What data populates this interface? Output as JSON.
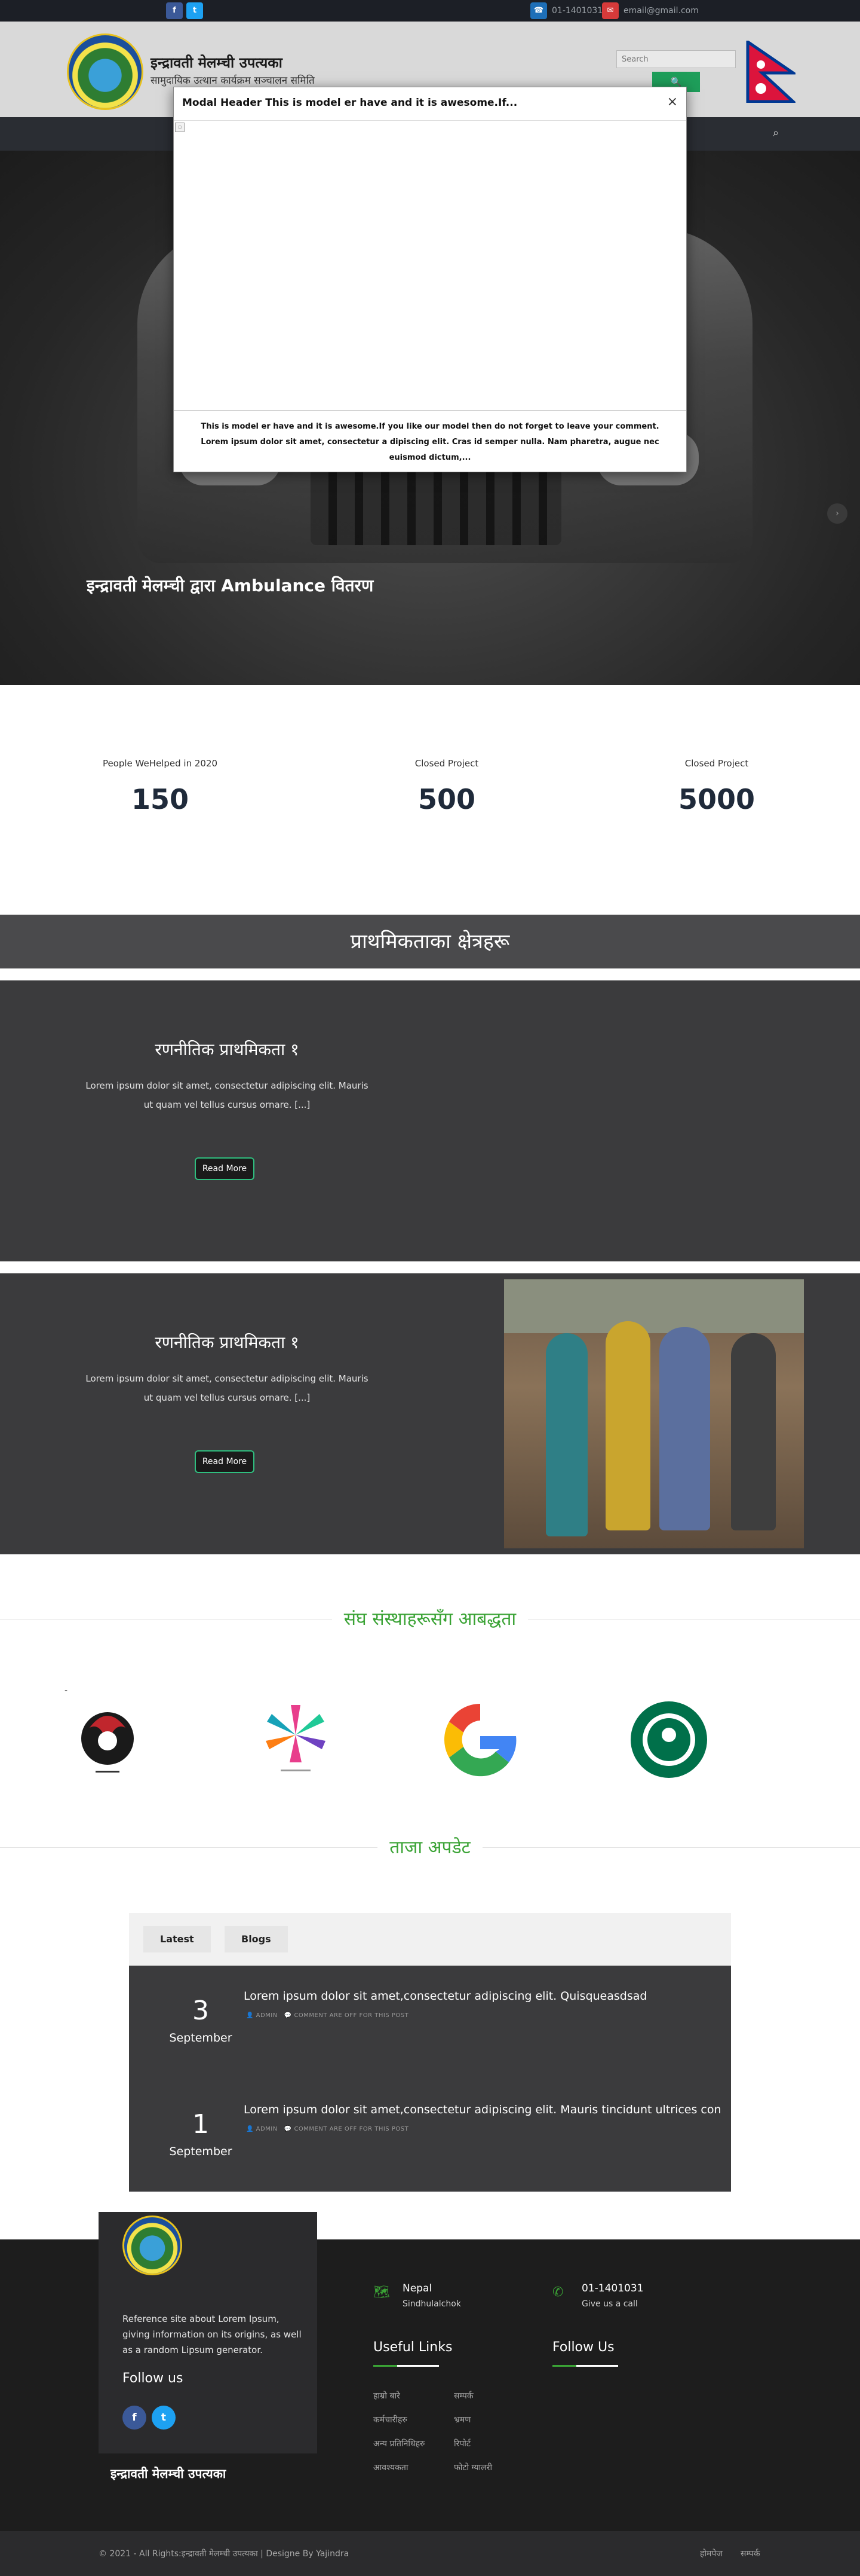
{
  "topbar": {
    "facebook_icon": "f",
    "twitter_icon": "t",
    "phone": "01-1401031",
    "email": "email@gmail.com"
  },
  "header": {
    "title": "इन्द्रावती मेलम्ची उपत्यका",
    "subtitle": "सामुदायिक उत्थान कार्यक्रम सञ्चालन समिति",
    "search_placeholder": "Search",
    "search_button": "🔍"
  },
  "modal": {
    "title": "Modal Header This is model er have and it is awesome.If...",
    "close": "×",
    "body": "This is model er have and it is awesome.If you like our model then do not forget to leave your comment. Lorem ipsum dolor sit amet, consectetur a dipiscing elit. Cras id semper nulla. Nam pharetra, augue nec euismod dictum,..."
  },
  "hero": {
    "caption": "इन्द्रावती मेलम्ची द्वारा Ambulance वितरण"
  },
  "stats": [
    {
      "label": "People WeHelped in 2020",
      "value": "150"
    },
    {
      "label": "Closed Project",
      "value": "500"
    },
    {
      "label": "Closed Project",
      "value": "5000"
    }
  ],
  "priorities": {
    "heading": "प्राथमिकताका क्षेत्रहरू",
    "items": [
      {
        "title": "रणनीतिक प्राथमिकता १",
        "text": "Lorem ipsum dolor sit amet, consectetur adipiscing elit. Mauris ut quam vel tellus cursus ornare. [...]",
        "button": "Read More"
      },
      {
        "title": "रणनीतिक प्राथमिकता १",
        "text": "Lorem ipsum dolor sit amet, consectetur adipiscing elit. Mauris ut quam vel tellus cursus ornare. [...]",
        "button": "Read More"
      }
    ]
  },
  "partners": {
    "heading": "संघ संस्थाहरूसँग आबद्धता",
    "dash": "-",
    "logos": [
      "dragon-logo",
      "flower-logo",
      "google-logo",
      "starbucks-logo"
    ]
  },
  "updates": {
    "heading": "ताजा अपडेट",
    "tabs": [
      "Latest",
      "Blogs"
    ],
    "news": [
      {
        "day": "3",
        "month": "September",
        "title": "Lorem ipsum dolor sit amet,consectetur adipiscing elit. Quisqueasdsad",
        "author": "ADMIN",
        "comments": "COMMENT ARE OFF FOR THIS POST"
      },
      {
        "day": "1",
        "month": "September",
        "title": "Lorem ipsum dolor sit amet,consectetur adipiscing elit. Mauris tincidunt ultrices consectetu",
        "author": "ADMIN",
        "comments": "COMMENT ARE OFF FOR THIS POST"
      }
    ]
  },
  "footer": {
    "about": "Reference site about Lorem Ipsum, giving information on its origins, as well as a random Lipsum generator.",
    "follow_us": "Follow us",
    "org_name": "इन्द्रावती मेलम्ची उपत्यका",
    "location_title": "Nepal",
    "location_sub": "Sindhulalchok",
    "phone_title": "01-1401031",
    "phone_sub": "Give us a call",
    "useful_links_title": "Useful Links",
    "follow_us_title": "Follow Us",
    "links_col1": [
      "हाम्रो बारे",
      "कर्मचारीहरु",
      "अन्य प्रतिनिधिहरु",
      "आवश्यकता"
    ],
    "links_col2": [
      "सम्पर्क",
      "भ्रमण",
      "रिपोर्ट",
      "फोटो ग्यालरी"
    ],
    "copyright": "© 2021 - All Rights:इन्द्रावती मेलम्ची उपत्यका | Designe By Yajindra",
    "bottom_links": [
      "होमपेज",
      "सम्पर्क"
    ]
  },
  "colors": {
    "accent_green": "#3aa335",
    "button_green": "#1e9e5a",
    "dark_section": "#3b3b3d",
    "footer_bg": "#1d1d1d"
  }
}
